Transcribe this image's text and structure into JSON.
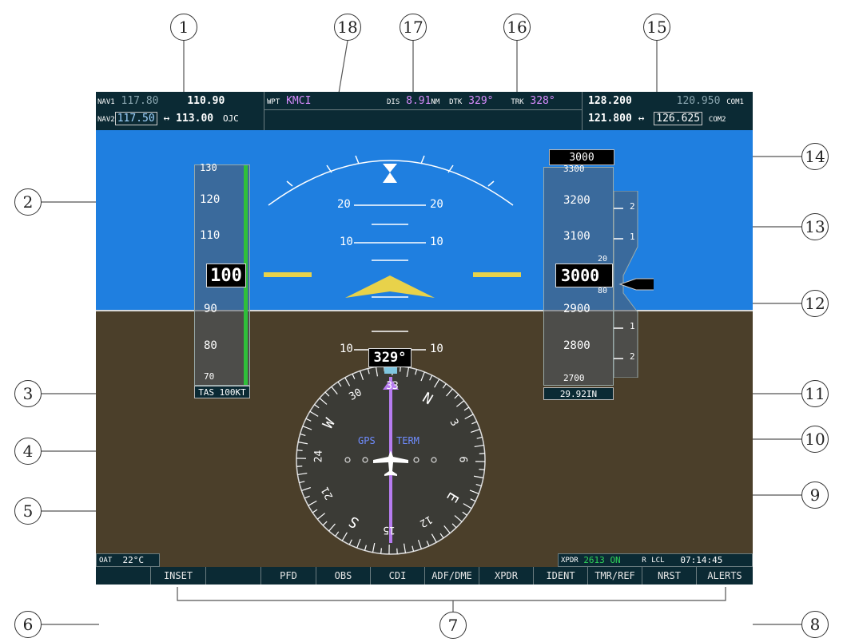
{
  "callouts": [
    "1",
    "2",
    "3",
    "4",
    "5",
    "6",
    "7",
    "8",
    "9",
    "10",
    "11",
    "12",
    "13",
    "14",
    "15",
    "16",
    "17",
    "18"
  ],
  "nav": {
    "nav1_label": "NAV1",
    "nav1_active": "117.80",
    "nav1_standby": "110.90",
    "nav2_label": "NAV2",
    "nav2_active": "117.50",
    "swap_arrow": "↔",
    "nav2_standby": "113.00",
    "nav2_ident": "OJC"
  },
  "nav_status": {
    "wpt_label": "WPT",
    "wpt_value": "KMCI",
    "dis_label": "DIS",
    "dis_value": "8.91",
    "dis_unit": "NM",
    "dtk_label": "DTK",
    "dtk_value": "329°",
    "trk_label": "TRK",
    "trk_value": "328°"
  },
  "com": {
    "com1_active": "128.200",
    "com1_standby": "120.950",
    "com1_label": "COM1",
    "com2_active": "121.800",
    "swap_arrow": "↔",
    "com2_standby": "126.625",
    "com2_label": "COM2"
  },
  "airspeed": {
    "ticks": [
      "130",
      "120",
      "110",
      "90",
      "80",
      "70"
    ],
    "current": "100",
    "tas": "TAS 100KT"
  },
  "attitude": {
    "pitch_labels": [
      "20",
      "20",
      "10",
      "10",
      "10",
      "10"
    ]
  },
  "altitude": {
    "selected": "3000",
    "ticks": [
      "3300",
      "3200",
      "3100",
      "2900",
      "2800",
      "2700"
    ],
    "current": "3000",
    "roll_top": "20",
    "roll_bottom": "80",
    "vsi_ticks": [
      "2",
      "1",
      "1",
      "2"
    ],
    "baro": "29.92IN"
  },
  "hsi": {
    "heading": "329°",
    "cardinal": [
      "N",
      "3",
      "6",
      "E",
      "12",
      "15",
      "S",
      "21",
      "24",
      "W",
      "30",
      "33"
    ],
    "gps_label": "GPS",
    "term_label": "TERM"
  },
  "status": {
    "oat_label": "OAT",
    "oat_value": "22°C",
    "xpdr_label": "XPDR",
    "xpdr_code": "2613",
    "xpdr_mode": "ON",
    "xpdr_reply": "R",
    "lcl_label": "LCL",
    "time": "07:14:45"
  },
  "softkeys": [
    "",
    "INSET",
    "",
    "PFD",
    "OBS",
    "CDI",
    "ADF/DME",
    "XPDR",
    "IDENT",
    "TMR/REF",
    "NRST",
    "ALERTS"
  ],
  "colors": {
    "sky": "#1f7fe0",
    "ground": "#4b3f2a",
    "bar": "#0b2a34",
    "aircraft_symbol": "#e8d24a",
    "course": "#b77cf0"
  }
}
